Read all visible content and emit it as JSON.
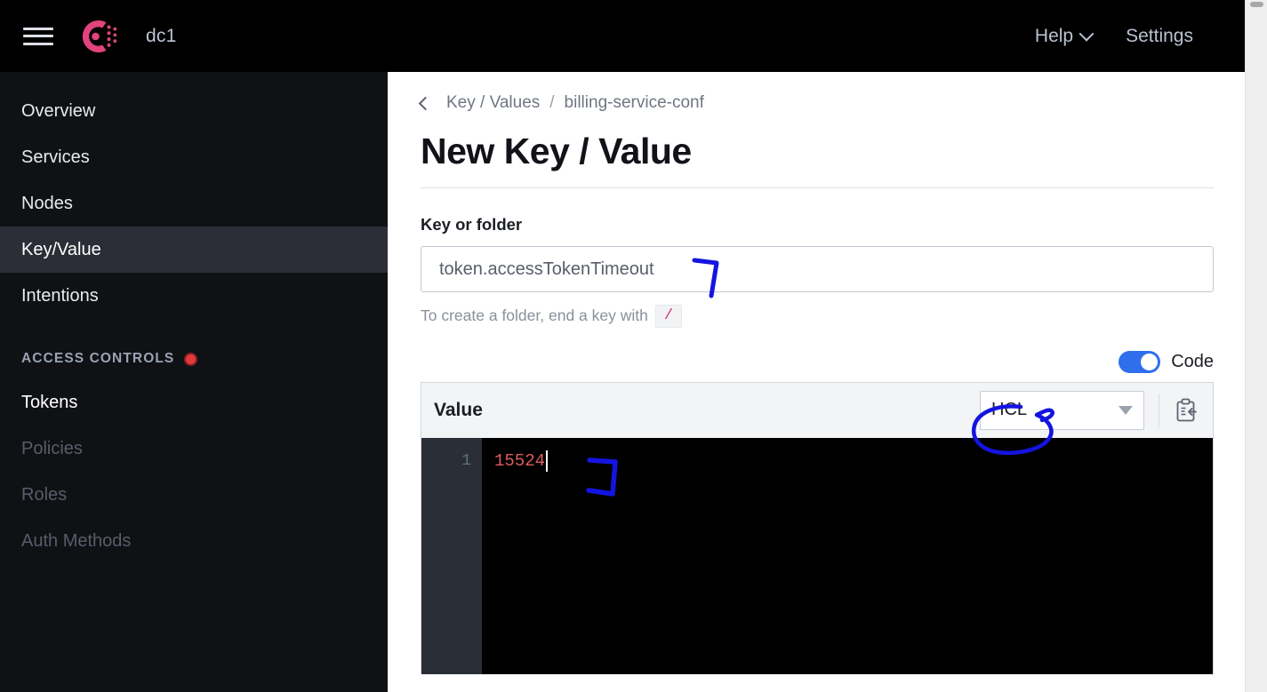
{
  "topbar": {
    "menu_icon": "hamburger-icon",
    "logo_icon": "consul-logo-icon",
    "datacenter": "dc1",
    "help_label": "Help",
    "settings_label": "Settings"
  },
  "sidebar": {
    "items": [
      {
        "label": "Overview",
        "state": "normal"
      },
      {
        "label": "Services",
        "state": "normal"
      },
      {
        "label": "Nodes",
        "state": "normal"
      },
      {
        "label": "Key/Value",
        "state": "active"
      },
      {
        "label": "Intentions",
        "state": "normal"
      }
    ],
    "section": {
      "label": "ACCESS CONTROLS",
      "badge_icon": "red-dot-icon",
      "badge_color": "#e03b3b"
    },
    "section_items": [
      {
        "label": "Tokens",
        "state": "bright"
      },
      {
        "label": "Policies",
        "state": "dim"
      },
      {
        "label": "Roles",
        "state": "dim"
      },
      {
        "label": "Auth Methods",
        "state": "dim"
      }
    ]
  },
  "main": {
    "breadcrumb": {
      "back_icon": "chevron-left-icon",
      "root": "Key / Values",
      "separator": "/",
      "current": "billing-service-conf"
    },
    "page_title": "New Key / Value",
    "key_field": {
      "label": "Key or folder",
      "value": "token.accessTokenTimeout",
      "placeholder": "",
      "help_prefix": "To create a folder, end a key with",
      "help_code": "/"
    },
    "code_toggle": {
      "label": "Code",
      "state": "on",
      "accent": "#2f6fed"
    },
    "value_panel": {
      "title": "Value",
      "language": "HCL",
      "dropdown_icon": "chevron-down-icon",
      "copy_icon": "copy-to-clipboard-icon",
      "editor": {
        "line_numbers": [
          "1"
        ],
        "lines": [
          "15524"
        ],
        "text_color": "#e05c5c",
        "background": "#000000"
      }
    }
  },
  "annotations": {
    "color": "#1414e0",
    "marks": [
      {
        "name": "bracket-mark-key-input"
      },
      {
        "name": "circle-mark-hcl"
      },
      {
        "name": "bracket-mark-editor"
      }
    ]
  },
  "scrollbar": {
    "name": "page-scrollbar"
  }
}
